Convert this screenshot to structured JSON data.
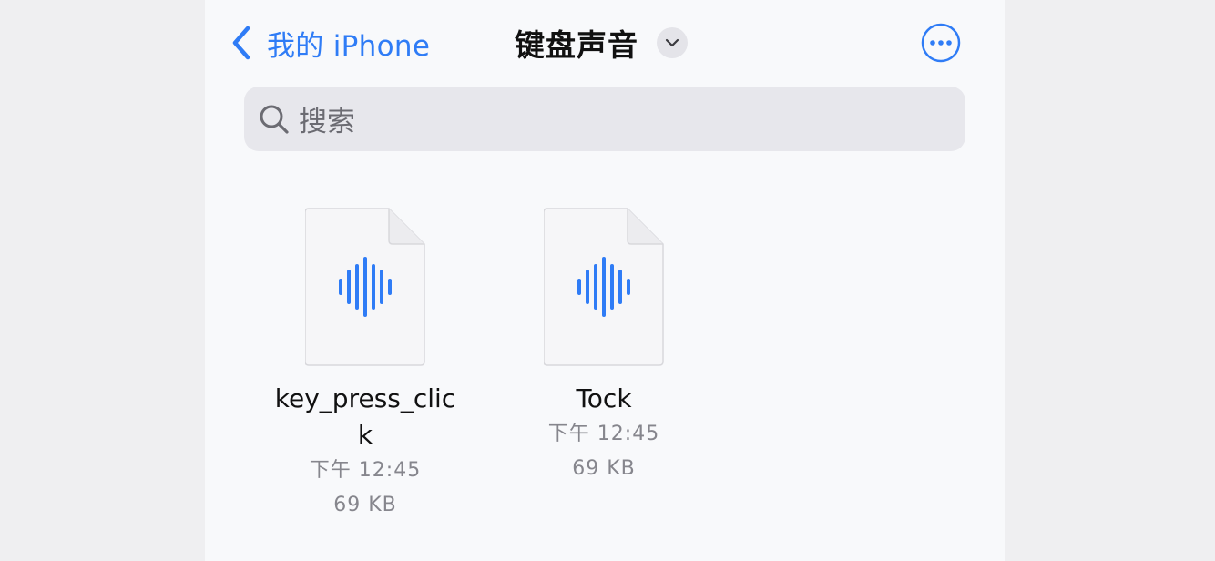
{
  "nav": {
    "back_label": "我的 iPhone",
    "title": "键盘声音"
  },
  "search": {
    "placeholder": "搜索"
  },
  "files": [
    {
      "name_line1": "key_press_clic",
      "name_line2": "k",
      "time": "下午 12:45",
      "size": "69 KB",
      "icon": "audio-file-icon"
    },
    {
      "name_line1": "Tock",
      "name_line2": "",
      "time": "下午 12:45",
      "size": "69 KB",
      "icon": "audio-file-icon"
    }
  ],
  "colors": {
    "accent": "#2f7cf6",
    "background": "#f8f9fb",
    "page": "#efeff1"
  }
}
